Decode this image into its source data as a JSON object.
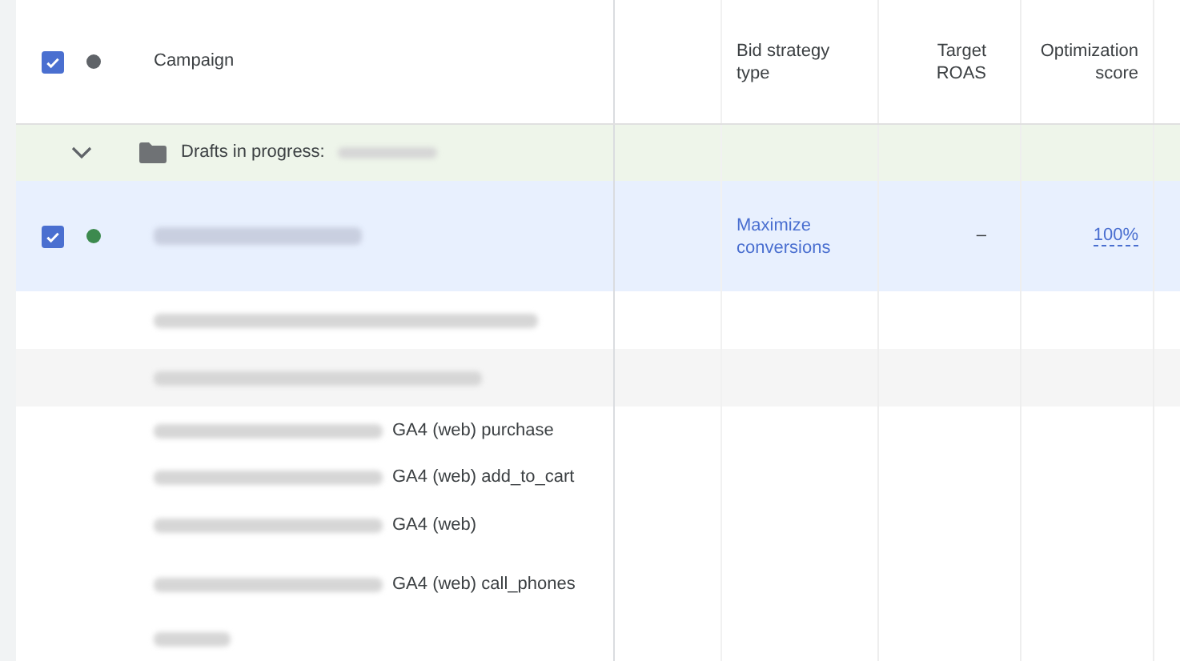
{
  "header": {
    "checked": true,
    "color": "#5f6368",
    "columns": [
      {
        "label": "Campaign"
      },
      {
        "label": "Bid strategy type"
      },
      {
        "label": "Target ROAS"
      },
      {
        "label": "Optimization score"
      }
    ]
  },
  "group_row": {
    "expanded": true,
    "label": "Drafts in progress:"
  },
  "rows": [
    {
      "kind": "campaign",
      "checked": true,
      "selected": true,
      "color": "#3c8a4e",
      "bid_strategy": "Maximize conversions",
      "target_roas": "–",
      "optimization_score": "100%"
    },
    {
      "kind": "blurred",
      "shaded": false
    },
    {
      "kind": "blurred",
      "shaded": true
    }
  ],
  "conversion_list": [
    {
      "label": "GA4 (web) purchase"
    },
    {
      "label": "GA4 (web) add_to_cart"
    },
    {
      "label": "GA4 (web)"
    },
    {
      "label": "GA4 (web) call_phones"
    },
    {
      "kind": "blurred"
    }
  ]
}
